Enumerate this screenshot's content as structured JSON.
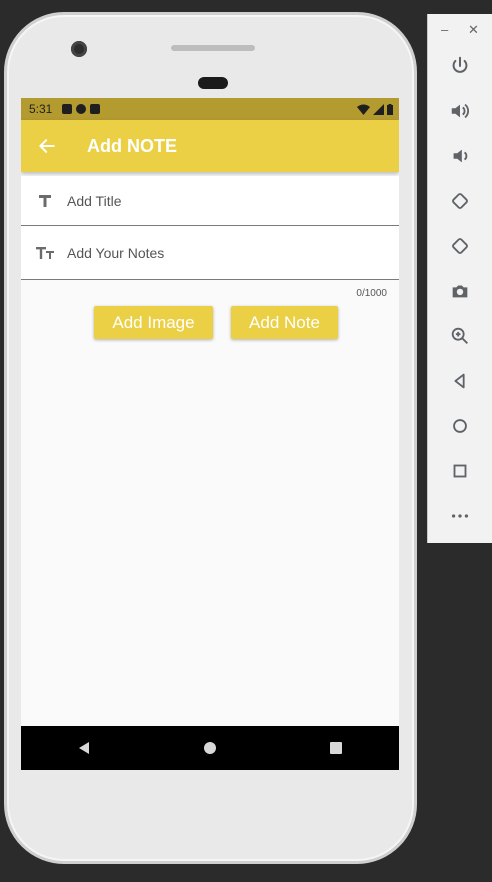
{
  "status_bar": {
    "time": "5:31"
  },
  "app_bar": {
    "title": "Add NOTE",
    "back_icon": "arrow-back-icon"
  },
  "form": {
    "title_field": {
      "placeholder": "Add Title",
      "value": "",
      "icon": "title-icon"
    },
    "notes_field": {
      "placeholder": "Add Your Notes",
      "value": "",
      "icon": "text-size-icon"
    },
    "counter": "0/1000"
  },
  "buttons": {
    "add_image": "Add Image",
    "add_note": "Add Note"
  },
  "nav_bar": {
    "back": "nav-back-icon",
    "home": "nav-home-icon",
    "recents": "nav-recents-icon"
  },
  "emulator_toolbar": {
    "items": [
      "power-icon",
      "volume-up-icon",
      "volume-down-icon",
      "rotate-left-icon",
      "rotate-right-icon",
      "camera-icon",
      "zoom-icon",
      "back-icon",
      "home-icon",
      "overview-icon",
      "more-icon"
    ]
  },
  "colors": {
    "accent": "#ebd045",
    "status_bar": "#b39b30",
    "nav_bar": "#000000"
  }
}
